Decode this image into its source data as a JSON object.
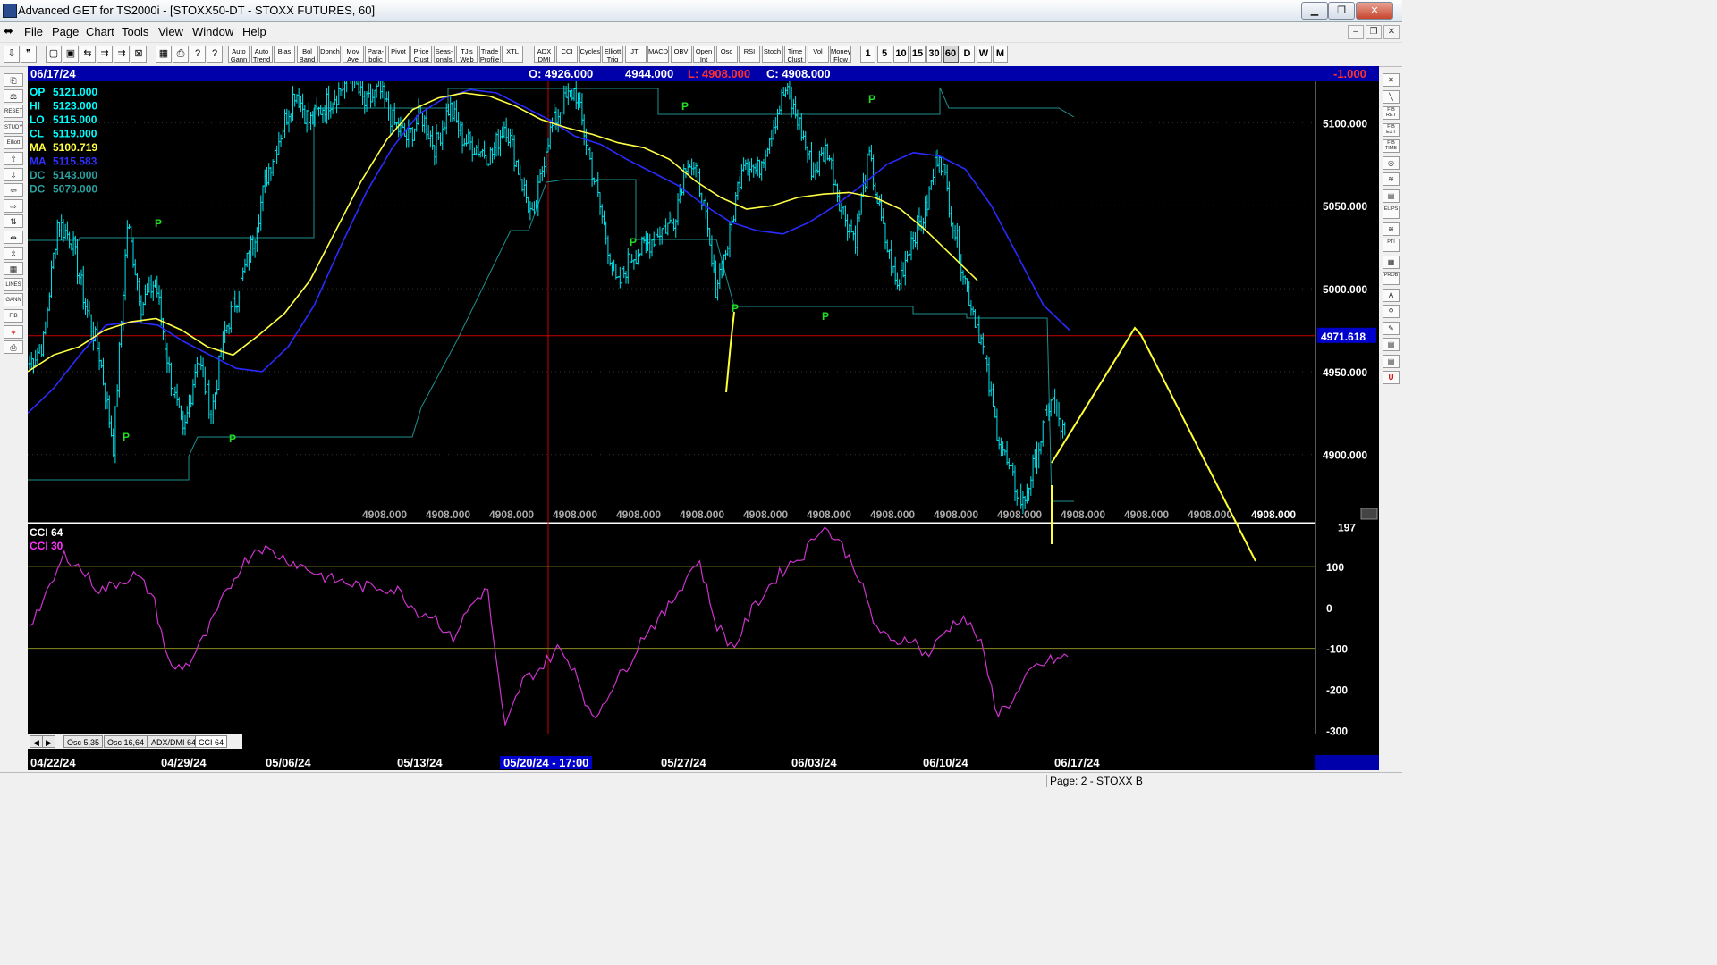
{
  "window": {
    "title": "Advanced GET for TS2000i - [STOXX50-DT - STOXX FUTURES, 60]",
    "minimize_label": "▁",
    "restore_label": "❐",
    "close_label": "✕"
  },
  "menu": {
    "items": [
      "File",
      "Page",
      "Chart",
      "Tools",
      "View",
      "Window",
      "Help"
    ],
    "mdi": [
      "–",
      "❐",
      "✕"
    ]
  },
  "toolbar": {
    "icons": [
      "⇩",
      "❞",
      "▢",
      "▣",
      "⇆",
      "⇉",
      "⇉",
      "⊠",
      "▦",
      "⎙",
      "?",
      "?"
    ],
    "studies": [
      "Auto Gann",
      "Auto Trend",
      "Bias",
      "Bol Band",
      "Donch",
      "Mov Ave",
      "Para- bolic",
      "Pivot",
      "Price Clust",
      "Seas- onals",
      "TJ's Web",
      "Trade Profile",
      "XTL",
      "ADX DMI",
      "CCI",
      "Cycles",
      "Elliott Trig",
      "JTI",
      "MACD",
      "OBV",
      "Open Int",
      "Osc",
      "RSI",
      "Stoch",
      "Time Clust",
      "Vol",
      "Money Flow"
    ],
    "intervals": [
      "1",
      "5",
      "10",
      "15",
      "30",
      "60",
      "D",
      "W",
      "M"
    ]
  },
  "left_tools": [
    "⎗",
    "⚖",
    "RESET",
    "STUDY",
    "Elliott",
    "⇧",
    "⇩",
    "⇦",
    "⇨",
    "⇅",
    "⇹",
    "⇳",
    "▦",
    "LINES",
    "GANN",
    "FIB",
    "+",
    "⎙"
  ],
  "right_tools": [
    "✕",
    "╲",
    "FIB RET",
    "FIB EXT",
    "FIB TIME",
    "◎",
    "≋",
    "▤",
    "ELIPS",
    "≋",
    "PTI",
    "▦",
    "PROB",
    "A",
    "⚲",
    "✎",
    "▤",
    "▤",
    "U"
  ],
  "infobar": {
    "date": "06/17/24",
    "open": "O: 4926.000",
    "high": "4944.000",
    "low": "L: 4908.000",
    "close": "C: 4908.000",
    "change": "-1.000"
  },
  "legend": [
    {
      "label": "OP",
      "value": "5121.000",
      "color": "#00ffff"
    },
    {
      "label": "HI",
      "value": "5123.000",
      "color": "#00ffff"
    },
    {
      "label": "LO",
      "value": "5115.000",
      "color": "#00ffff"
    },
    {
      "label": "CL",
      "value": "5119.000",
      "color": "#00ffff"
    },
    {
      "label": "MA",
      "value": "5100.719",
      "color": "#ffff44"
    },
    {
      "label": "MA",
      "value": "5115.583",
      "color": "#3030ff"
    },
    {
      "label": "DC",
      "value": "5143.000",
      "color": "#2aa0a0"
    },
    {
      "label": "DC",
      "value": "5079.000",
      "color": "#2aa0a0"
    }
  ],
  "price_axis": {
    "ticks": [
      "5100.000",
      "5050.000",
      "5000.000",
      "4950.000",
      "4900.000"
    ],
    "cursor_price": "4971.618"
  },
  "price_readouts": [
    "4908.000",
    "4908.000",
    "4908.000",
    "4908.000",
    "4908.000",
    "4908.000",
    "4908.000",
    "4908.000",
    "4908.000",
    "4908.000",
    "4908.000",
    "4908.000",
    "4908.000",
    "4908.000",
    "4908.000"
  ],
  "pivot_label": "P",
  "oscillator": {
    "label1": "CCI 64",
    "label2": "CCI  30",
    "ticks": [
      "197",
      "100",
      "0",
      "-100",
      "-200",
      "-300"
    ]
  },
  "tabs": [
    "◀",
    "▶",
    "Osc 5,35",
    "Osc 16,64",
    "ADX/DMI 64",
    "CCI 64"
  ],
  "date_axis": {
    "labels": [
      "04/22/24",
      "04/29/24",
      "05/06/24",
      "05/13/24",
      "05/20/24 - 17:00",
      "05/27/24",
      "06/03/24",
      "06/10/24",
      "06/17/24"
    ]
  },
  "status": {
    "page": "Page: 2 - STOXX B"
  },
  "colors": {
    "background": "#000000",
    "candles": "#00e5ee",
    "ma_fast": "#ffff44",
    "ma_slow": "#2a2aff",
    "donchian": "#1f8f8f",
    "pivot": "#22dd22",
    "cci": "#cc33cc",
    "drawing": "#ffff33",
    "cursor_line": "#cc0000",
    "info_bg": "#0000aa"
  },
  "chart_data": {
    "type": "candlestick",
    "symbol": "STOXX50-DT",
    "interval": "60",
    "ylim": [
      4860,
      5125
    ],
    "y_ticks": [
      4900,
      4950,
      5000,
      5050,
      5100
    ],
    "dates": [
      "04/22/24",
      "04/29/24",
      "05/06/24",
      "05/13/24",
      "05/20/24",
      "05/27/24",
      "06/03/24",
      "06/10/24",
      "06/17/24"
    ],
    "close_path": [
      4955,
      4968,
      5040,
      5030,
      4990,
      4960,
      4905,
      5040,
      4990,
      5005,
      4950,
      4910,
      4960,
      4925,
      4975,
      5000,
      5030,
      5070,
      5095,
      5120,
      5100,
      5110,
      5118,
      5128,
      5110,
      5120,
      5100,
      5090,
      5105,
      5085,
      5110,
      5090,
      5085,
      5080,
      5100,
      5070,
      5040,
      5090,
      5110,
      5120,
      5080,
      5040,
      5000,
      5020,
      5025,
      5035,
      5040,
      5080,
      5060,
      5000,
      5030,
      5080,
      5070,
      5095,
      5120,
      5100,
      5070,
      5085,
      5050,
      5030,
      5080,
      5035,
      5000,
      5030,
      5045,
      5085,
      5040,
      5000,
      4970,
      4920,
      4890,
      4870,
      4900,
      4935,
      4910
    ],
    "ma_fast_path": [
      4950,
      4960,
      4965,
      4975,
      4980,
      4982,
      4975,
      4965,
      4960,
      4972,
      4985,
      5005,
      5035,
      5065,
      5090,
      5108,
      5115,
      5118,
      5116,
      5110,
      5102,
      5097,
      5093,
      5088,
      5085,
      5078,
      5065,
      5055,
      5048,
      5050,
      5055,
      5057,
      5058,
      5055,
      5048,
      5035,
      5020,
      5005
    ],
    "ma_slow_path": [
      4925,
      4940,
      4960,
      4978,
      4980,
      4978,
      4968,
      4960,
      4952,
      4950,
      4965,
      4990,
      5025,
      5058,
      5085,
      5105,
      5115,
      5120,
      5118,
      5110,
      5102,
      5092,
      5087,
      5078,
      5070,
      5062,
      5050,
      5040,
      5035,
      5033,
      5040,
      5050,
      5062,
      5075,
      5082,
      5080,
      5072,
      5050,
      5020,
      4990,
      4975
    ],
    "cursor_price": 4971.618,
    "cci_path": [
      -40,
      30,
      130,
      90,
      40,
      60,
      80,
      30,
      -150,
      -140,
      -70,
      20,
      100,
      150,
      130,
      110,
      90,
      70,
      60,
      50,
      50,
      40,
      -10,
      -20,
      -80,
      0,
      50,
      -300,
      -180,
      -150,
      -100,
      -150,
      -280,
      -200,
      -140,
      -60,
      -20,
      50,
      120,
      -40,
      -100,
      -10,
      50,
      100,
      130,
      200,
      160,
      90,
      -40,
      -90,
      -70,
      -120,
      -60,
      -20,
      -80,
      -260,
      -220,
      -150,
      -130,
      -120
    ],
    "cci_levels": [
      100,
      -100
    ],
    "cci_ylim": [
      -310,
      200
    ]
  }
}
